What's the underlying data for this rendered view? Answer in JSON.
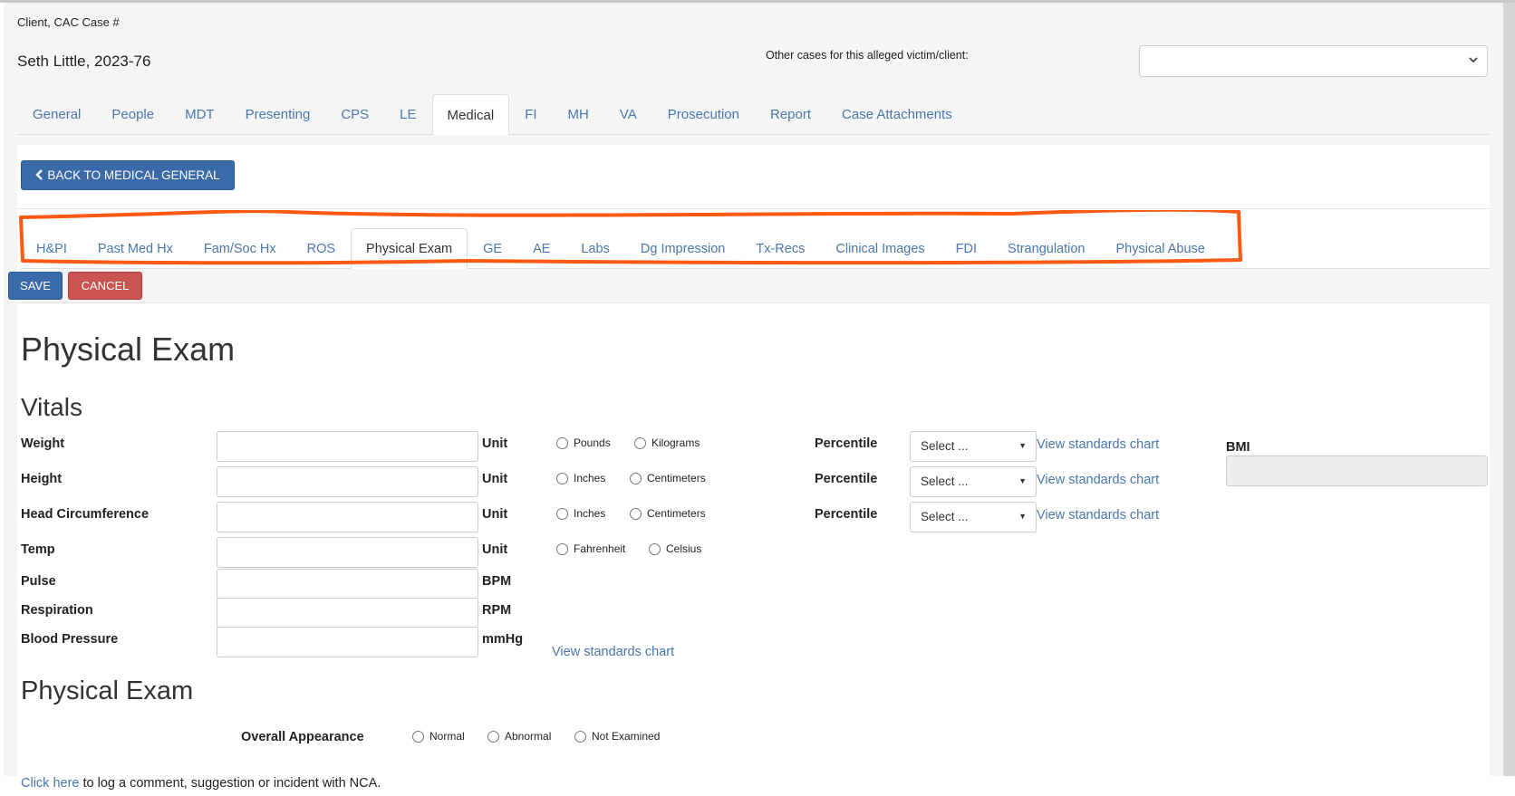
{
  "header": {
    "client_label": "Client, CAC Case #",
    "client_name": "Seth Little, 2023-76",
    "other_cases_label": "Other cases for this alleged victim/client:",
    "other_cases_value": ""
  },
  "main_tabs": [
    "General",
    "People",
    "MDT",
    "Presenting",
    "CPS",
    "LE",
    "Medical",
    "FI",
    "MH",
    "VA",
    "Prosecution",
    "Report",
    "Case Attachments"
  ],
  "main_tab_active": "Medical",
  "back_button": "BACK TO MEDICAL GENERAL",
  "sub_tabs": [
    "H&PI",
    "Past Med Hx",
    "Fam/Soc Hx",
    "ROS",
    "Physical Exam",
    "GE",
    "AE",
    "Labs",
    "Dg Impression",
    "Tx-Recs",
    "Clinical Images",
    "FDI",
    "Strangulation",
    "Physical Abuse"
  ],
  "sub_tab_active": "Physical Exam",
  "highlight_color": "#ff5a14",
  "actions": {
    "save": "SAVE",
    "cancel": "CANCEL"
  },
  "page_title": "Physical Exam",
  "vitals": {
    "title": "Vitals",
    "rows": [
      {
        "label": "Weight",
        "value": "",
        "unit_label": "Unit",
        "options": [
          "Pounds",
          "Kilograms"
        ],
        "percentile_label": "Percentile",
        "percentile_value": "Select ...",
        "chart_link": "View standards chart"
      },
      {
        "label": "Height",
        "value": "",
        "unit_label": "Unit",
        "options": [
          "Inches",
          "Centimeters"
        ],
        "percentile_label": "Percentile",
        "percentile_value": "Select ...",
        "chart_link": "View standards chart"
      },
      {
        "label": "Head Circumference",
        "value": "",
        "unit_label": "Unit",
        "options": [
          "Inches",
          "Centimeters"
        ],
        "percentile_label": "Percentile",
        "percentile_value": "Select ...",
        "chart_link": "View standards chart"
      },
      {
        "label": "Temp",
        "value": "",
        "unit_label": "Unit",
        "options": [
          "Fahrenheit",
          "Celsius"
        ]
      },
      {
        "label": "Pulse",
        "value": "",
        "unit_label": "BPM"
      },
      {
        "label": "Respiration",
        "value": "",
        "unit_label": "RPM"
      },
      {
        "label": "Blood Pressure",
        "value": "",
        "unit_label": "mmHg",
        "chart_link": "View standards chart"
      }
    ],
    "bmi_label": "BMI",
    "bmi_value": ""
  },
  "physical_exam": {
    "title": "Physical Exam",
    "overall_appearance_label": "Overall Appearance",
    "overall_appearance_options": [
      "Normal",
      "Abnormal",
      "Not Examined"
    ]
  },
  "footer": {
    "link": "Click here",
    "text": " to log a comment, suggestion or incident with NCA."
  },
  "colors": {
    "primary": "#3a6aa8",
    "danger": "#c9534f",
    "link": "#4a77ad"
  }
}
